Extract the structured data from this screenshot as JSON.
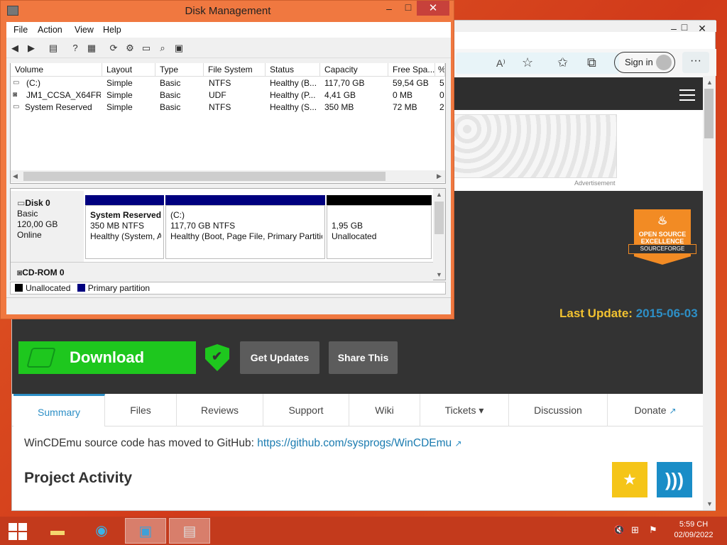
{
  "browser": {
    "signin_label": "Sign in",
    "more_label": "···",
    "ad_label": "Advertisement",
    "badge_text": "OPEN SOURCE EXCELLENCE",
    "badge_ribbon": "SOURCEFORGE",
    "last_update_label": "Last Update:",
    "last_update_date": "2015-06-03",
    "download_label": "Download",
    "get_updates_label": "Get Updates",
    "share_label": "Share This",
    "tabs": [
      "Summary",
      "Files",
      "Reviews",
      "Support",
      "Wiki",
      "Tickets ▾",
      "Discussion",
      "Donate"
    ],
    "moved_text": "WinCDEmu source code has moved to GitHub: ",
    "moved_link": "https://github.com/sysprogs/WinCDEmu",
    "activity_heading": "Project Activity",
    "accent_color": "#2d8fc6",
    "download_color": "#1ec71e"
  },
  "diskmgmt": {
    "title": "Disk Management",
    "menu": [
      "File",
      "Action",
      "View",
      "Help"
    ],
    "columns": [
      "Volume",
      "Layout",
      "Type",
      "File System",
      "Status",
      "Capacity",
      "Free Spa...",
      "%"
    ],
    "volumes": [
      [
        "(C:)",
        "Simple",
        "Basic",
        "NTFS",
        "Healthy (B...",
        "117,70 GB",
        "59,54 GB",
        "5"
      ],
      [
        "JM1_CCSA_X64FR...",
        "Simple",
        "Basic",
        "UDF",
        "Healthy (P...",
        "4,41 GB",
        "0 MB",
        "0"
      ],
      [
        "System Reserved",
        "Simple",
        "Basic",
        "NTFS",
        "Healthy (S...",
        "350 MB",
        "72 MB",
        "2"
      ]
    ],
    "disk0": {
      "name": "Disk 0",
      "type": "Basic",
      "size": "120,00 GB",
      "state": "Online"
    },
    "partitions": [
      {
        "name": "System Reserved",
        "size": "350 MB NTFS",
        "status": "Healthy (System, A"
      },
      {
        "name": "(C:)",
        "size": "117,70 GB NTFS",
        "status": "Healthy (Boot, Page File, Primary Partitic"
      },
      {
        "name": "",
        "size": "1,95 GB",
        "status": "Unallocated"
      }
    ],
    "cdrom_name": "CD-ROM 0",
    "legend_unallocated": "Unallocated",
    "legend_primary": "Primary partition",
    "primary_color": "#00007f",
    "unallocated_color": "#000000"
  },
  "taskbar": {
    "time": "5:59 CH",
    "date": "02/09/2022"
  }
}
